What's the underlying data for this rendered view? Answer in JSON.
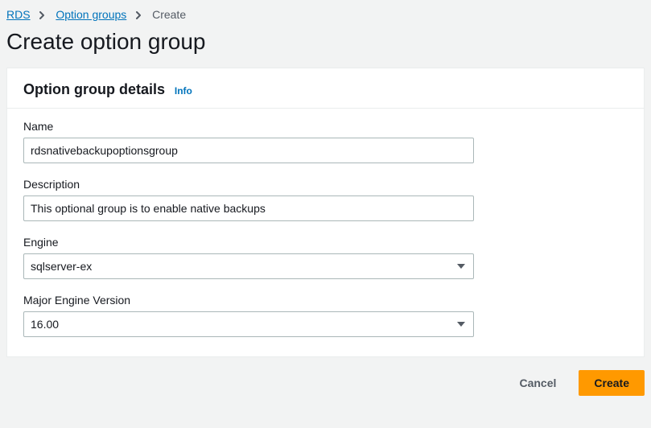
{
  "breadcrumb": {
    "items": [
      {
        "label": "RDS",
        "link": true
      },
      {
        "label": "Option groups",
        "link": true
      },
      {
        "label": "Create",
        "link": false
      }
    ]
  },
  "page": {
    "title": "Create option group"
  },
  "panel": {
    "title": "Option group details",
    "info_label": "Info"
  },
  "form": {
    "name": {
      "label": "Name",
      "value": "rdsnativebackupoptionsgroup"
    },
    "description": {
      "label": "Description",
      "value": "This optional group is to enable native backups"
    },
    "engine": {
      "label": "Engine",
      "value": "sqlserver-ex"
    },
    "major_engine_version": {
      "label": "Major Engine Version",
      "value": "16.00"
    }
  },
  "buttons": {
    "cancel": "Cancel",
    "create": "Create"
  }
}
